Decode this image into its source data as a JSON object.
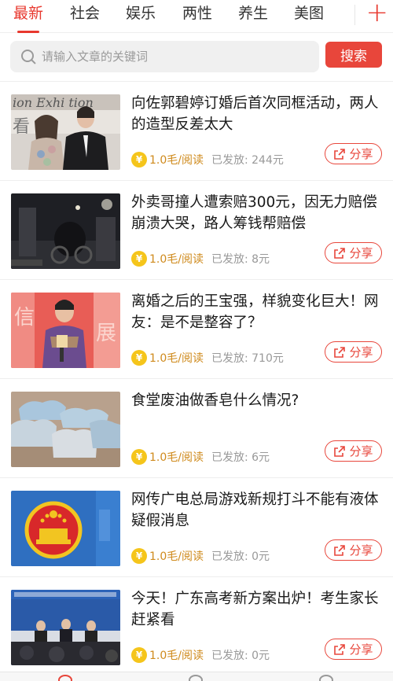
{
  "tabs": [
    {
      "label": "最新",
      "active": true
    },
    {
      "label": "社会",
      "active": false
    },
    {
      "label": "娱乐",
      "active": false
    },
    {
      "label": "两性",
      "active": false
    },
    {
      "label": "养生",
      "active": false
    },
    {
      "label": "美图",
      "active": false
    }
  ],
  "tab_add_label": "+",
  "search": {
    "placeholder": "请输入文章的关键词",
    "button_label": "搜索"
  },
  "coin_glyph": "¥",
  "articles": [
    {
      "title": "向佐郭碧婷订婚后首次同框活动，两人的造型反差太大",
      "price": "1.0毛/阅读",
      "sent": "已发放: 244元",
      "share": "分享",
      "image": "couple-event-photo"
    },
    {
      "title": "外卖哥撞人遭索赔300元，因无力赔偿崩溃大哭，路人筹钱帮赔偿",
      "price": "1.0毛/阅读",
      "sent": "已发放: 8元",
      "share": "分享",
      "image": "night-street-photo"
    },
    {
      "title": "离婚之后的王宝强，样貌变化巨大！网友：是不是整容了？",
      "price": "1.0毛/阅读",
      "sent": "已发放: 710元",
      "share": "分享",
      "image": "man-with-microphone-photo"
    },
    {
      "title": "食堂废油做香皂什么情况?",
      "price": "1.0毛/阅读",
      "sent": "已发放: 6元",
      "share": "分享",
      "image": "soap-bars-photo"
    },
    {
      "title": "网传广电总局游戏新规打斗不能有液体疑假消息",
      "price": "1.0毛/阅读",
      "sent": "已发放: 0元",
      "share": "分享",
      "image": "national-emblem-photo"
    },
    {
      "title": "今天！广东高考新方案出炉！考生家长赶紧看",
      "price": "1.0毛/阅读",
      "sent": "已发放: 0元",
      "share": "分享",
      "image": "press-conference-photo"
    }
  ],
  "colors": {
    "accent": "#e8382e",
    "coin": "#f5c51b",
    "price": "#cf8a1c",
    "muted": "#999999"
  }
}
